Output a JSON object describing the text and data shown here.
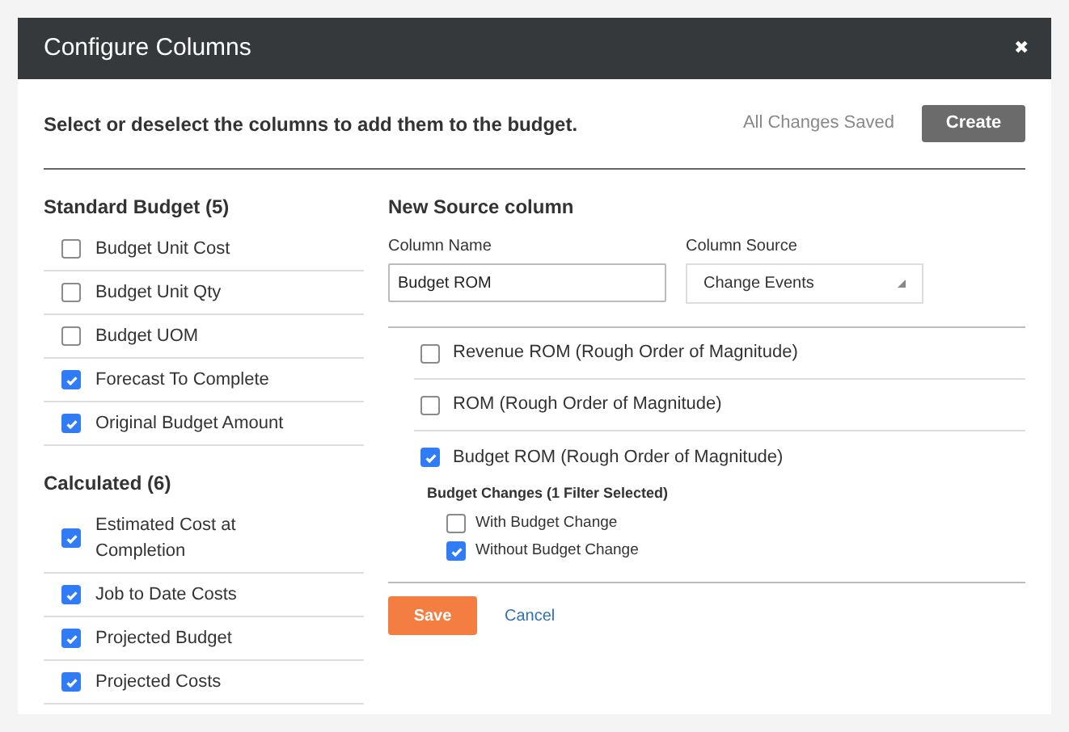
{
  "window": {
    "title": "Configure Columns",
    "close": "✖"
  },
  "instructions": "Select or deselect the columns to add them to the budget.",
  "save_status": "All Changes Saved",
  "create_button": "Create",
  "groups": [
    {
      "title": "Standard Budget (5)",
      "items": [
        {
          "label": "Budget Unit Cost",
          "checked": false
        },
        {
          "label": "Budget Unit Qty",
          "checked": false
        },
        {
          "label": "Budget UOM",
          "checked": false
        },
        {
          "label": "Forecast To Complete",
          "checked": true
        },
        {
          "label": "Original Budget Amount",
          "checked": true
        }
      ]
    },
    {
      "title": "Calculated (6)",
      "items": [
        {
          "label": "Estimated Cost at Completion",
          "checked": true
        },
        {
          "label": "Job to Date Costs",
          "checked": true
        },
        {
          "label": "Projected Budget",
          "checked": true
        },
        {
          "label": "Projected Costs",
          "checked": true
        }
      ]
    }
  ],
  "new_source": {
    "title": "New Source column",
    "column_name": {
      "label": "Column Name",
      "value": "Budget ROM"
    },
    "column_source": {
      "label": "Column Source",
      "value": "Change Events"
    },
    "options": [
      {
        "label": "Revenue ROM (Rough Order of Magnitude)",
        "checked": false
      },
      {
        "label": "ROM (Rough Order of Magnitude)",
        "checked": false
      },
      {
        "label": "Budget ROM (Rough Order of Magnitude)",
        "checked": true,
        "filter": {
          "title": "Budget Changes (1 Filter Selected)",
          "items": [
            {
              "label": "With Budget Change",
              "checked": false
            },
            {
              "label": "Without Budget Change",
              "checked": true
            }
          ]
        }
      }
    ],
    "save": "Save",
    "cancel": "Cancel"
  }
}
